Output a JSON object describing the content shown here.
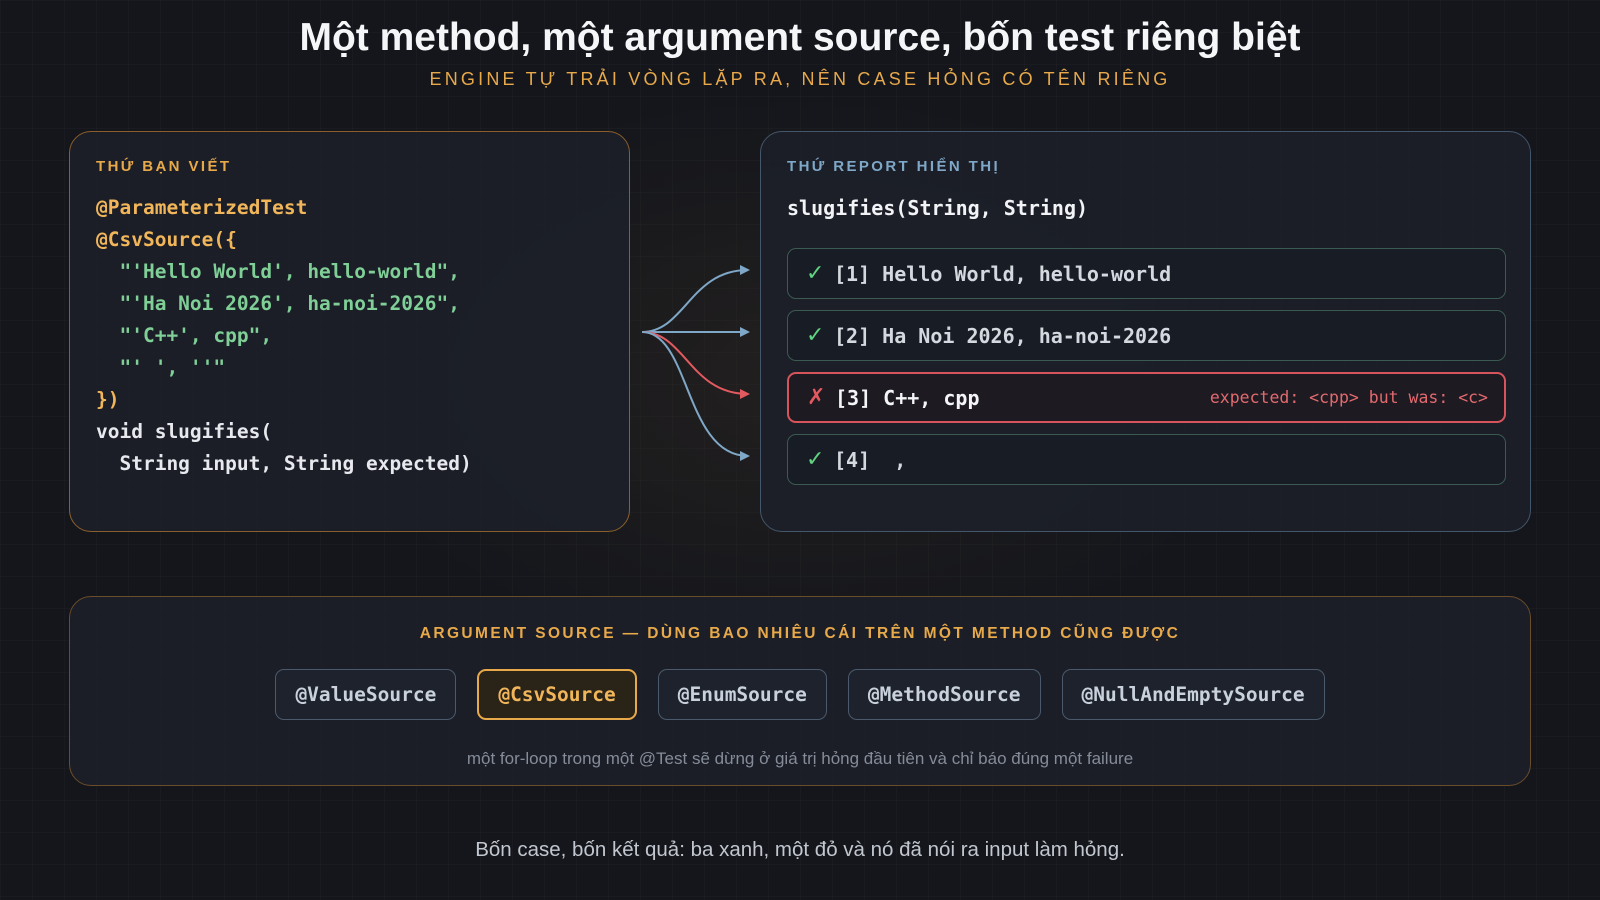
{
  "header": {
    "title": "Một method, một argument source, bốn test riêng biệt",
    "subtitle": "ENGINE TỰ TRẢI VÒNG LẶP RA, NÊN CASE HỎNG CÓ TÊN RIÊNG"
  },
  "left_panel": {
    "label": "THỨ BẠN VIẾT",
    "code_lines": [
      "@ParameterizedTest",
      "@CsvSource({",
      "  \"'Hello World', hello-world\",",
      "  \"'Ha Noi 2026', ha-noi-2026\",",
      "  \"'C++', cpp\",",
      "  \"' ', ''\"",
      "})",
      "void slugifies(",
      "  String input, String expected)"
    ]
  },
  "right_panel": {
    "label": "THỨ REPORT HIỂN THỊ",
    "signature": "slugifies(String, String)",
    "results": [
      {
        "status": "pass",
        "mark": "✓",
        "text": "[1] Hello World, hello-world"
      },
      {
        "status": "pass",
        "mark": "✓",
        "text": "[2] Ha Noi 2026, ha-noi-2026"
      },
      {
        "status": "fail",
        "mark": "✗",
        "text": "[3] C++, cpp",
        "error": "expected: <cpp> but was: <c>"
      },
      {
        "status": "pass",
        "mark": "✓",
        "text": "[4]  ,"
      }
    ]
  },
  "sources": {
    "heading": "ARGUMENT SOURCE — DÙNG BAO NHIÊU CÁI TRÊN MỘT METHOD CŨNG ĐƯỢC",
    "chips": [
      {
        "label": "@ValueSource",
        "active": false
      },
      {
        "label": "@CsvSource",
        "active": true
      },
      {
        "label": "@EnumSource",
        "active": false
      },
      {
        "label": "@MethodSource",
        "active": false
      },
      {
        "label": "@NullAndEmptySource",
        "active": false
      }
    ],
    "note": "một for-loop trong một @Test sẽ dừng ở giá trị hỏng đầu tiên và chỉ báo đúng một failure"
  },
  "footer": "Bốn case, bốn kết quả: ba xanh, một đỏ và nó đã nói ra input làm hỏng.",
  "colors": {
    "accent_orange": "#e8a94a",
    "pass_green": "#5fd37f",
    "fail_red": "#e25a60",
    "arrow_blue": "#7fa7c7"
  }
}
